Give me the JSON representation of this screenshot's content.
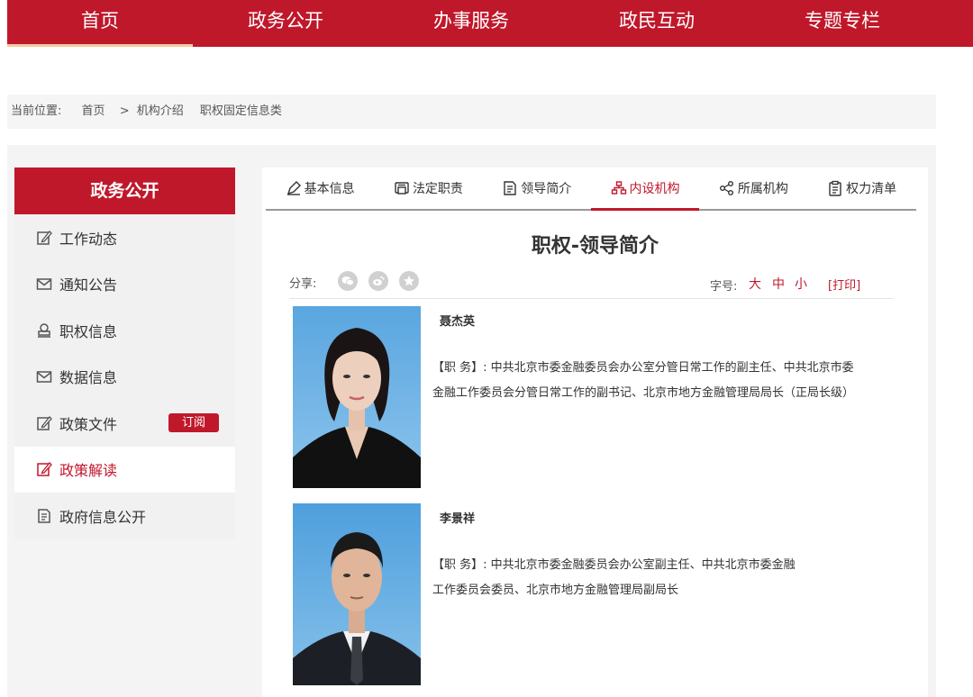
{
  "topnav": {
    "items": [
      {
        "label": "首页",
        "active": true
      },
      {
        "label": "政务公开"
      },
      {
        "label": "办事服务"
      },
      {
        "label": "政民互动"
      },
      {
        "label": "专题专栏"
      }
    ]
  },
  "breadcrumb": {
    "prefix": "当前位置:",
    "home": "首页",
    "sep": ">",
    "level2": "机构介绍",
    "level3": "职权固定信息类"
  },
  "sidebar": {
    "title": "政务公开",
    "items": [
      {
        "label": "工作动态",
        "icon": "edit-icon"
      },
      {
        "label": "通知公告",
        "icon": "mail-icon"
      },
      {
        "label": "职权信息",
        "icon": "stamp-icon"
      },
      {
        "label": "数据信息",
        "icon": "mail-icon"
      },
      {
        "label": "政策文件",
        "icon": "edit-icon",
        "badge": "订阅"
      },
      {
        "label": "政策解读",
        "icon": "edit-icon",
        "active": true
      },
      {
        "label": "政府信息公开",
        "icon": "document-icon"
      }
    ]
  },
  "tabs": [
    {
      "label": "基本信息",
      "icon": "pen-icon"
    },
    {
      "label": "法定职责",
      "icon": "printer-icon"
    },
    {
      "label": "领导简介",
      "icon": "document-icon"
    },
    {
      "label": "内设机构",
      "icon": "org-chart-icon",
      "active": true
    },
    {
      "label": "所属机构",
      "icon": "share-nodes-icon"
    },
    {
      "label": "权力清单",
      "icon": "clipboard-icon"
    }
  ],
  "page_title": "职权-领导简介",
  "share": {
    "label": "分享:",
    "icons": [
      "wechat-icon",
      "weibo-icon",
      "favorite-icon"
    ]
  },
  "font_size": {
    "label": "字号:",
    "large": "大",
    "medium": "中",
    "small": "小",
    "print": "[打印]"
  },
  "leaders": [
    {
      "name": "聂杰英",
      "duty_line1": "【职 务】: 中共北京市委金融委员会办公室分管日常工作的副主任、中共北京市委",
      "duty_line2": "金融工作委员会分管日常工作的副书记、北京市地方金融管理局局长（正局长级）"
    },
    {
      "name": "李景祥",
      "duty_line1": "【职 务】: 中共北京市委金融委员会办公室副主任、中共北京市委金融",
      "duty_line2": "工作委员会委员、北京市地方金融管理局副局长"
    }
  ],
  "colors": {
    "brand_red": "#c0182b",
    "nav_underline": "#f1c9a4"
  }
}
